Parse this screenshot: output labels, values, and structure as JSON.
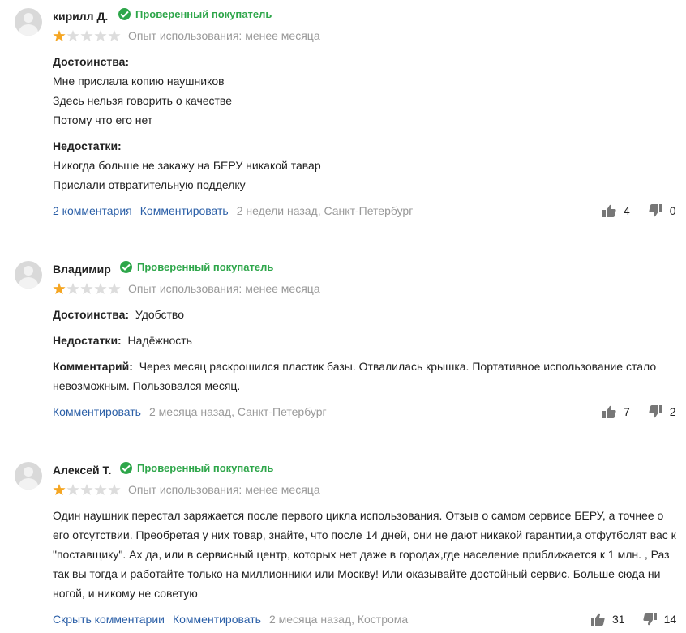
{
  "reviews": [
    {
      "author": "кирилл Д.",
      "verified": "Проверенный покупатель",
      "rating": 1,
      "usage": "Опыт использования: менее месяца",
      "pros_label": "Достоинства:",
      "pros_lines": [
        "Мне прислала копию наушников",
        "Здесь нельзя говорить о качестве",
        "Потому что его нет"
      ],
      "cons_label": "Недостатки:",
      "cons_lines": [
        "Никогда больше не закажу на БЕРУ никакой тавар",
        "Прислали отвратительную подделку"
      ],
      "comments_link": "2 комментария",
      "comment_action": "Комментировать",
      "meta": "2 недели назад, Санкт-Петербург",
      "likes": "4",
      "dislikes": "0"
    },
    {
      "author": "Владимир",
      "verified": "Проверенный покупатель",
      "rating": 1,
      "usage": "Опыт использования: менее месяца",
      "pros_label": "Достоинства:",
      "pros_text": "Удобство",
      "cons_label": "Недостатки:",
      "cons_text": "Надёжность",
      "comment_label": "Комментарий:",
      "comment_line1": "Через месяц раскрошился пластик базы. Отвалилась крышка. Портативное использование стало",
      "comment_line2": "невозможным. Пользовался месяц.",
      "comment_action": "Комментировать",
      "meta": "2 месяца назад, Санкт-Петербург",
      "likes": "7",
      "dislikes": "2"
    },
    {
      "author": "Алексей Т.",
      "verified": "Проверенный покупатель",
      "rating": 1,
      "usage": "Опыт использования: менее месяца",
      "text_lines": [
        "Один наушник перестал заряжается после первого цикла использования. Отзыв о самом сервисе БЕРУ, а точнее о",
        "его отсутствии. Преобретая у них товар, знайте, что после 14 дней, они не дают никакой гарантии,а отфутболят вас к",
        "\"поставщику\". Ах да, или в сервисный центр, которых нет даже в городах,где население приближается к 1 млн. , Раз",
        "так вы тогда и работайте только на миллионники или Москву! Или оказывайте достойный сервис. Больше сюда ни",
        "ногой, и никому не советую"
      ],
      "hide_comments": "Скрыть комментарии",
      "comment_action": "Комментировать",
      "meta": "2 месяца назад, Кострома",
      "likes": "31",
      "dislikes": "14"
    }
  ],
  "colors": {
    "verified": "#2ea64a",
    "link": "#2b5fa7",
    "star_on": "#f5a623",
    "star_off": "#dddddd",
    "meta": "#999999"
  },
  "icons": {
    "avatar": "user-avatar-placeholder",
    "verified": "checkmark-circle-icon",
    "like": "thumbs-up-icon",
    "dislike": "thumbs-down-icon",
    "star": "star-icon"
  }
}
